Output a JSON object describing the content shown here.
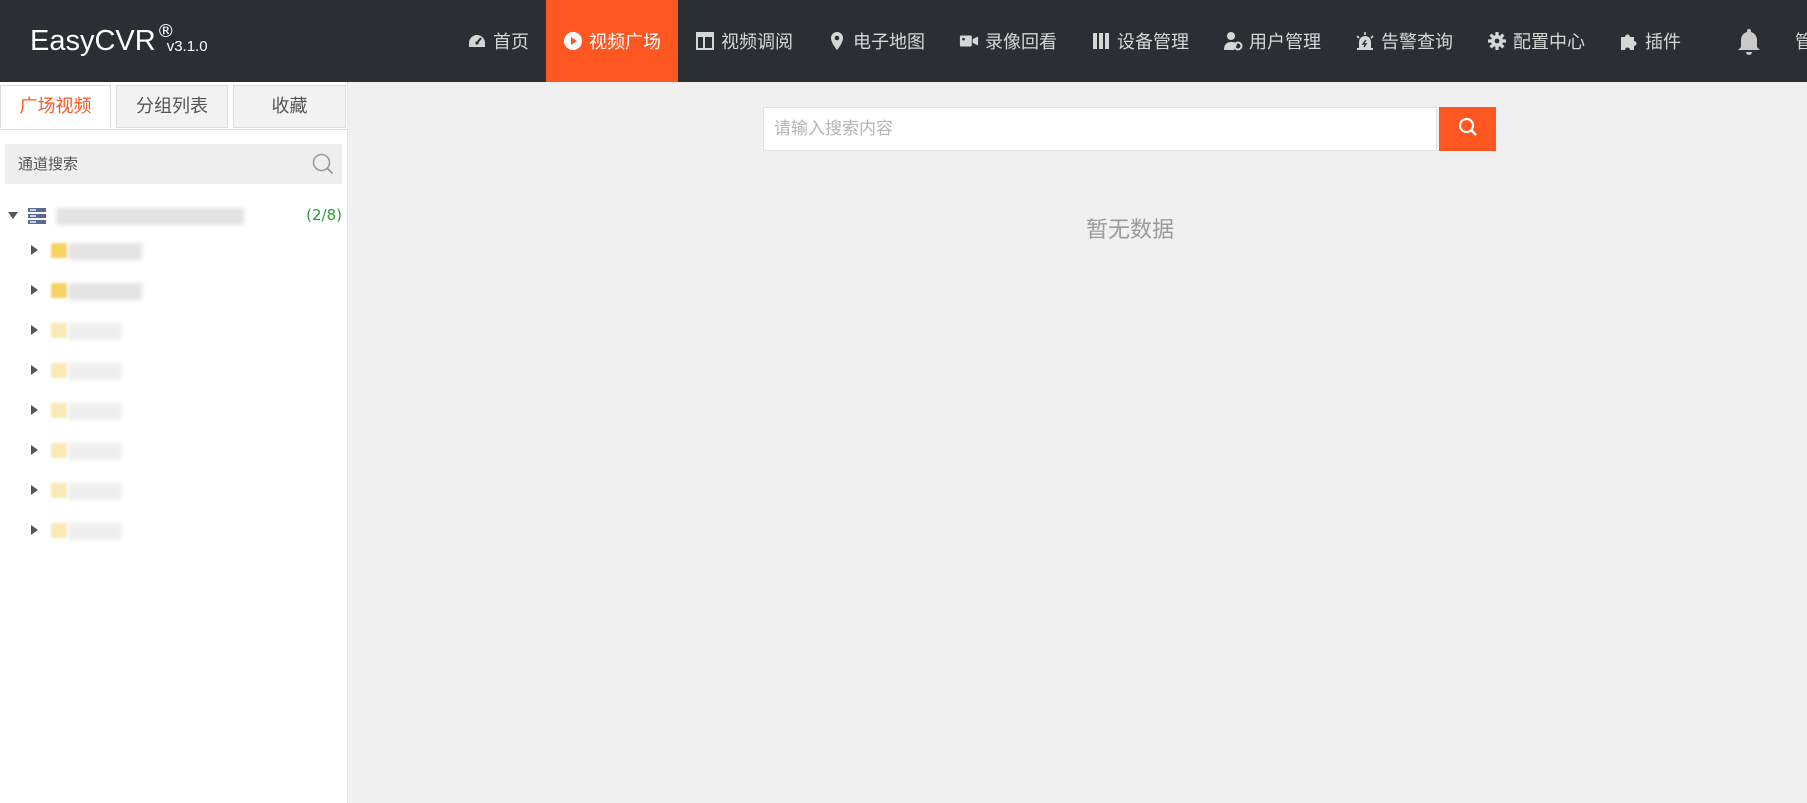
{
  "brand": {
    "name": "EasyCVR",
    "reg": "®",
    "version": "v3.1.0"
  },
  "nav": {
    "items": [
      {
        "label": "首页",
        "icon": "dashboard-icon"
      },
      {
        "label": "视频广场",
        "icon": "play-circle-icon",
        "active": true
      },
      {
        "label": "视频调阅",
        "icon": "layout-icon"
      },
      {
        "label": "电子地图",
        "icon": "map-pin-icon"
      },
      {
        "label": "录像回看",
        "icon": "video-camera-icon"
      },
      {
        "label": "设备管理",
        "icon": "device-icon"
      },
      {
        "label": "用户管理",
        "icon": "user-gear-icon"
      },
      {
        "label": "告警查询",
        "icon": "alarm-icon"
      },
      {
        "label": "配置中心",
        "icon": "gear-icon"
      },
      {
        "label": "插件",
        "icon": "puzzle-icon"
      }
    ],
    "overflow_text": "管"
  },
  "sidebar": {
    "tabs": [
      "广场视频",
      "分组列表",
      "收藏"
    ],
    "search_placeholder": "通道搜索",
    "tree": {
      "root_count": "(2/8)"
    }
  },
  "main": {
    "search_placeholder": "请输入搜索内容",
    "empty_text": "暂无数据"
  },
  "colors": {
    "accent": "#ff5722",
    "topbar": "#2b2f33",
    "count": "#2e9a3a"
  }
}
